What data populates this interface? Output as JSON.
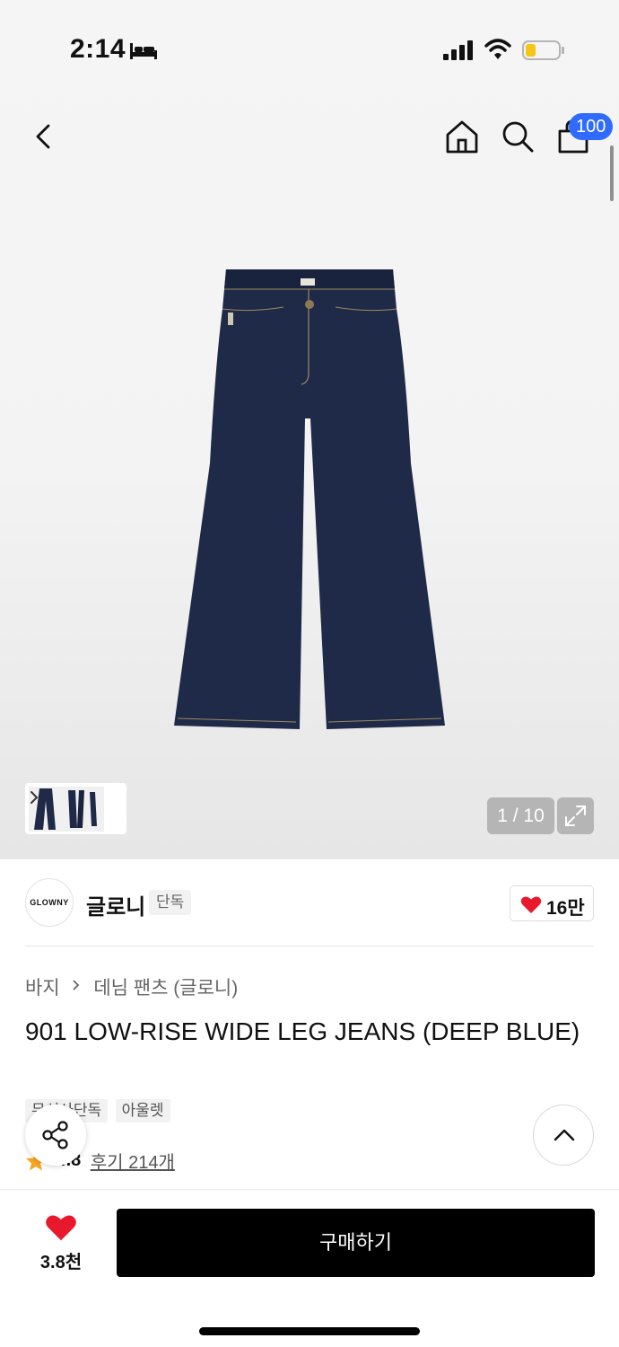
{
  "status_bar": {
    "time": "2:14",
    "icons": [
      "bed-icon",
      "cellular-signal-icon",
      "wifi-icon",
      "battery-low-icon"
    ],
    "battery_color": "#f5c518"
  },
  "nav": {
    "icons": [
      "back-icon",
      "home-icon",
      "search-icon",
      "bag-icon"
    ],
    "cart_badge": "100",
    "badge_color": "#2f6bff"
  },
  "gallery": {
    "counter": "1 / 10",
    "icons": [
      "chevron-right-icon",
      "expand-icon"
    ]
  },
  "brand": {
    "logo_text": "GLOWNY",
    "name": "글로니",
    "tag": "단독",
    "likes": "16만"
  },
  "product": {
    "breadcrumb": [
      "바지",
      "데님 팬츠 (글로니)"
    ],
    "title": "901 LOW-RISE WIDE LEG JEANS (DEEP BLUE)",
    "chips": [
      "무신사단독",
      "아울렛"
    ],
    "rating": "4.8",
    "reviews": "후기 214개"
  },
  "bottom_bar": {
    "like_count": "3.8천",
    "buy_label": "구매하기",
    "heart_color": "#e8192c"
  }
}
